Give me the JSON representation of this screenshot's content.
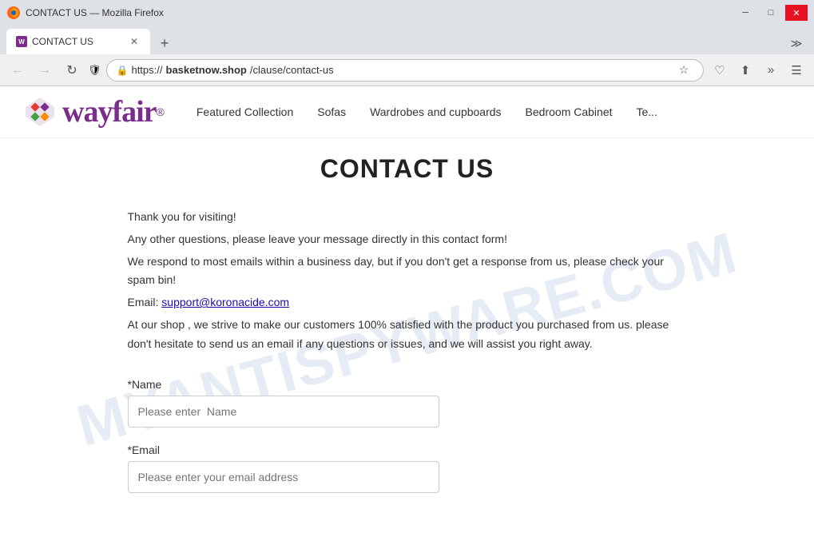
{
  "browser": {
    "title": "CONTACT US — Mozilla Firefox",
    "tab_label": "CONTACT US",
    "url_prefix": "https://",
    "url_bold": "basketnow.shop",
    "url_suffix": "/clause/contact-us",
    "nav_back_disabled": true,
    "nav_forward_disabled": true
  },
  "nav": {
    "back_label": "←",
    "forward_label": "→",
    "refresh_label": "↻",
    "new_tab_label": "+",
    "tab_overflow_label": "≫",
    "more_label": "☰",
    "shield_label": "🛡",
    "lock_label": "🔒",
    "star_label": "☆",
    "extensions_label": "⊕",
    "chevron_label": "›"
  },
  "site": {
    "logo_text": "wayfair",
    "logo_reg": "®",
    "nav_items": [
      {
        "label": "Featured Collection"
      },
      {
        "label": "Sofas"
      },
      {
        "label": "Wardrobes and cupboards"
      },
      {
        "label": "Bedroom Cabinet"
      },
      {
        "label": "Te..."
      }
    ]
  },
  "page": {
    "title": "CONTACT US",
    "watermark": "MYANTISPYWARE.COM",
    "intro_line1": "Thank you for visiting!",
    "intro_line2": "Any other questions, please leave your message directly in this contact form!",
    "intro_line3": "We respond to most emails within a business day, but if you don't get a response from us, please check your spam bin!",
    "email_label": "Email: ",
    "email_address": "support@koronacide.com",
    "closing_para": "At our shop , we strive to make our customers 100% satisfied with the product you purchased from us. please don't hesitate to send us an email if any questions or issues, and we will assist you right away.",
    "form": {
      "name_label": "*Name",
      "name_placeholder": "Please enter  Name",
      "email_label": "*Email",
      "email_placeholder": "Please enter your email address"
    }
  }
}
